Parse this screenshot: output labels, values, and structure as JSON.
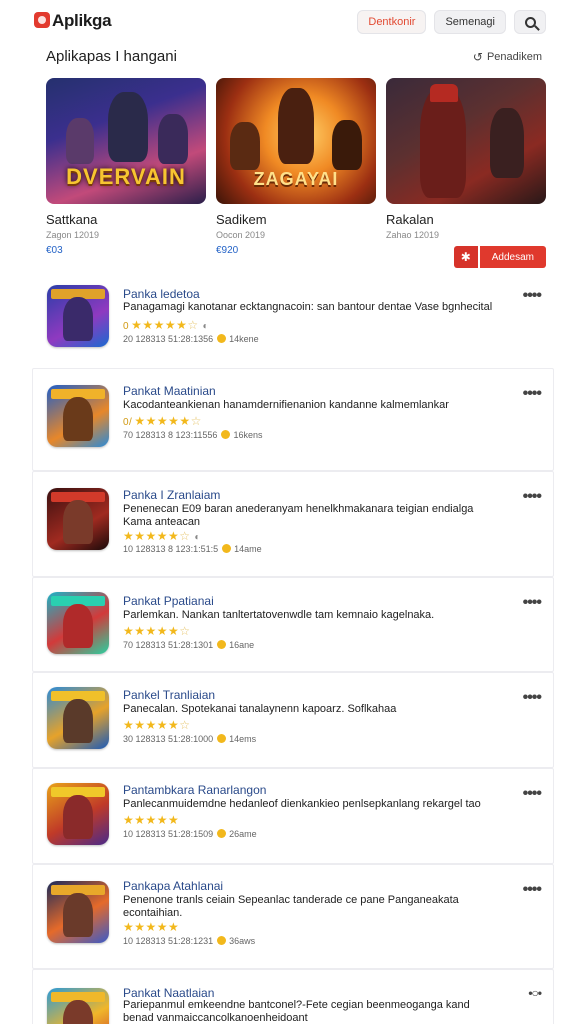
{
  "app": {
    "title": "Aplikga"
  },
  "header": {
    "btn_primary": "Dentkonir",
    "btn_secondary": "Semenagi"
  },
  "section": {
    "title": "Aplikapas I hangani",
    "link": "Penadikem"
  },
  "featured": [
    {
      "name": "Sattkana",
      "meta": "Zagon 12019",
      "price": "€03",
      "art_title": "DVERVAIN"
    },
    {
      "name": "Sadikem",
      "meta": "Oocon 2019",
      "price": "€920",
      "art_title": "ZAGAYAI"
    },
    {
      "name": "Rakalan",
      "meta": "Zahao 12019",
      "price": "",
      "art_title": ""
    }
  ],
  "add_button": {
    "label": "Addesam"
  },
  "apps": [
    {
      "title": "Panka ledetoa",
      "desc": "Panagamagi kanotanar ecktangnacoin: san bantour dentae Vase bgnhecital",
      "stars_prefix": "0",
      "rating": 4.5,
      "foot": "20 128313 51:28:1356",
      "foot_tail": "14kene"
    },
    {
      "title": "Pankat Maatinian",
      "desc": "Kacodanteankienan hanamdernifienanion kandanne kalmemlankar",
      "stars_prefix": "0/",
      "rating": 4.5,
      "foot": "70 128313 8 123:11556",
      "foot_tail": "16kens"
    },
    {
      "title": "Panka I Zranlaiam",
      "desc": "Penenecan E09 baran anederanyam henelkhmakanara teigian endialga Kama anteacan",
      "stars_prefix": "",
      "rating": 4.5,
      "foot": "10 128313 8 123:1:51:5",
      "foot_tail": "14ame"
    },
    {
      "title": "Pankat Ppatianai",
      "desc": "Parlemkan. Nankan tanltertatovenwdle tam kemnaio kagelnaka.",
      "stars_prefix": "",
      "rating": 4.5,
      "foot": "70 128313 51:28:1301",
      "foot_tail": "16ane"
    },
    {
      "title": "Pankel Tranliaian",
      "desc": "Panecalan. Spotekanai tanalaynenn kapoarz. Soflkahaa",
      "stars_prefix": "",
      "rating": 4.5,
      "foot": "30 128313 51:28:1000",
      "foot_tail": "14ems"
    },
    {
      "title": "Pantambkara Ranarlangon",
      "desc": "Panlecanmuidemdne hedanleof dienkankieo penlsepkanlang rekargel tao",
      "stars_prefix": "",
      "rating": 5,
      "foot": "10 128313 51:28:1509",
      "foot_tail": "26ame"
    },
    {
      "title": "Pankapa Atahlanai",
      "desc": "Penenone tranls ceiain Sepeanlac tanderade ce pane Panganeakata econtaihian.",
      "stars_prefix": "",
      "rating": 5,
      "foot": "10 128313 51:28:1231",
      "foot_tail": "36aws"
    },
    {
      "title": "Pankat Naatlaian",
      "desc": "Pariepanmul emkeendne bantconel?-Fete cegian beenmeoganga kand benad vanmaiccancolkanoenheidoant",
      "stars_prefix": "",
      "rating": 0,
      "foot": "",
      "foot_tail": ""
    }
  ],
  "colors": {
    "accent": "#e0392d",
    "star": "#f2b81c",
    "title_blue": "#2a4a8a",
    "price_blue": "#2463c7"
  },
  "icons": [
    "app-logo-icon",
    "search-icon",
    "refresh-icon",
    "plus-icon",
    "more-icon",
    "star-icon",
    "coin-icon"
  ]
}
